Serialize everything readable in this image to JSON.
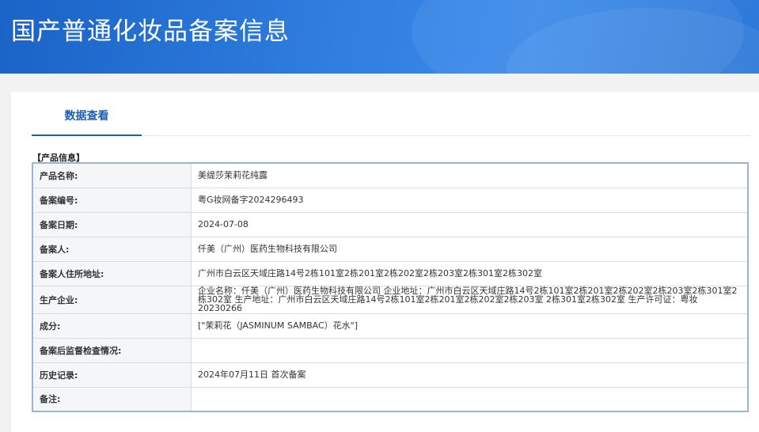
{
  "header": {
    "title": "国产普通化妆品备案信息"
  },
  "tabs": [
    {
      "label": "数据查看"
    }
  ],
  "section": {
    "title": "【产品信息】"
  },
  "rows": [
    {
      "label": "产品名称:",
      "value": "美缇莎茉莉花纯露"
    },
    {
      "label": "备案编号:",
      "value": "粤G妆网备字2024296493"
    },
    {
      "label": "备案日期:",
      "value": "2024-07-08"
    },
    {
      "label": "备案人:",
      "value": "仟美（广州）医药生物科技有限公司"
    },
    {
      "label": "备案人住所地址:",
      "value": "广州市白云区天域庄路14号2栋101室2栋201室2栋202室2栋203室2栋301室2栋302室"
    },
    {
      "label": "生产企业:",
      "value": "企业名称：仟美（广州）医药生物科技有限公司 企业地址：广州市白云区天域庄路14号2栋101室2栋201室2栋202室2栋203室2栋301室2栋302室 生产地址：广州市白云区天域庄路14号2栋101室2栋201室2栋202室2栋203室 2栋301室2栋302室 生产许可证：粤妆20230266"
    },
    {
      "label": "成分:",
      "value": "[\"茉莉花（JASMINUM SAMBAC）花水\"]"
    },
    {
      "label": "备案后监督检查情况:",
      "value": ""
    },
    {
      "label": "历史记录:",
      "value": "2024年07月11日 首次备案"
    },
    {
      "label": "备注:",
      "value": ""
    }
  ]
}
